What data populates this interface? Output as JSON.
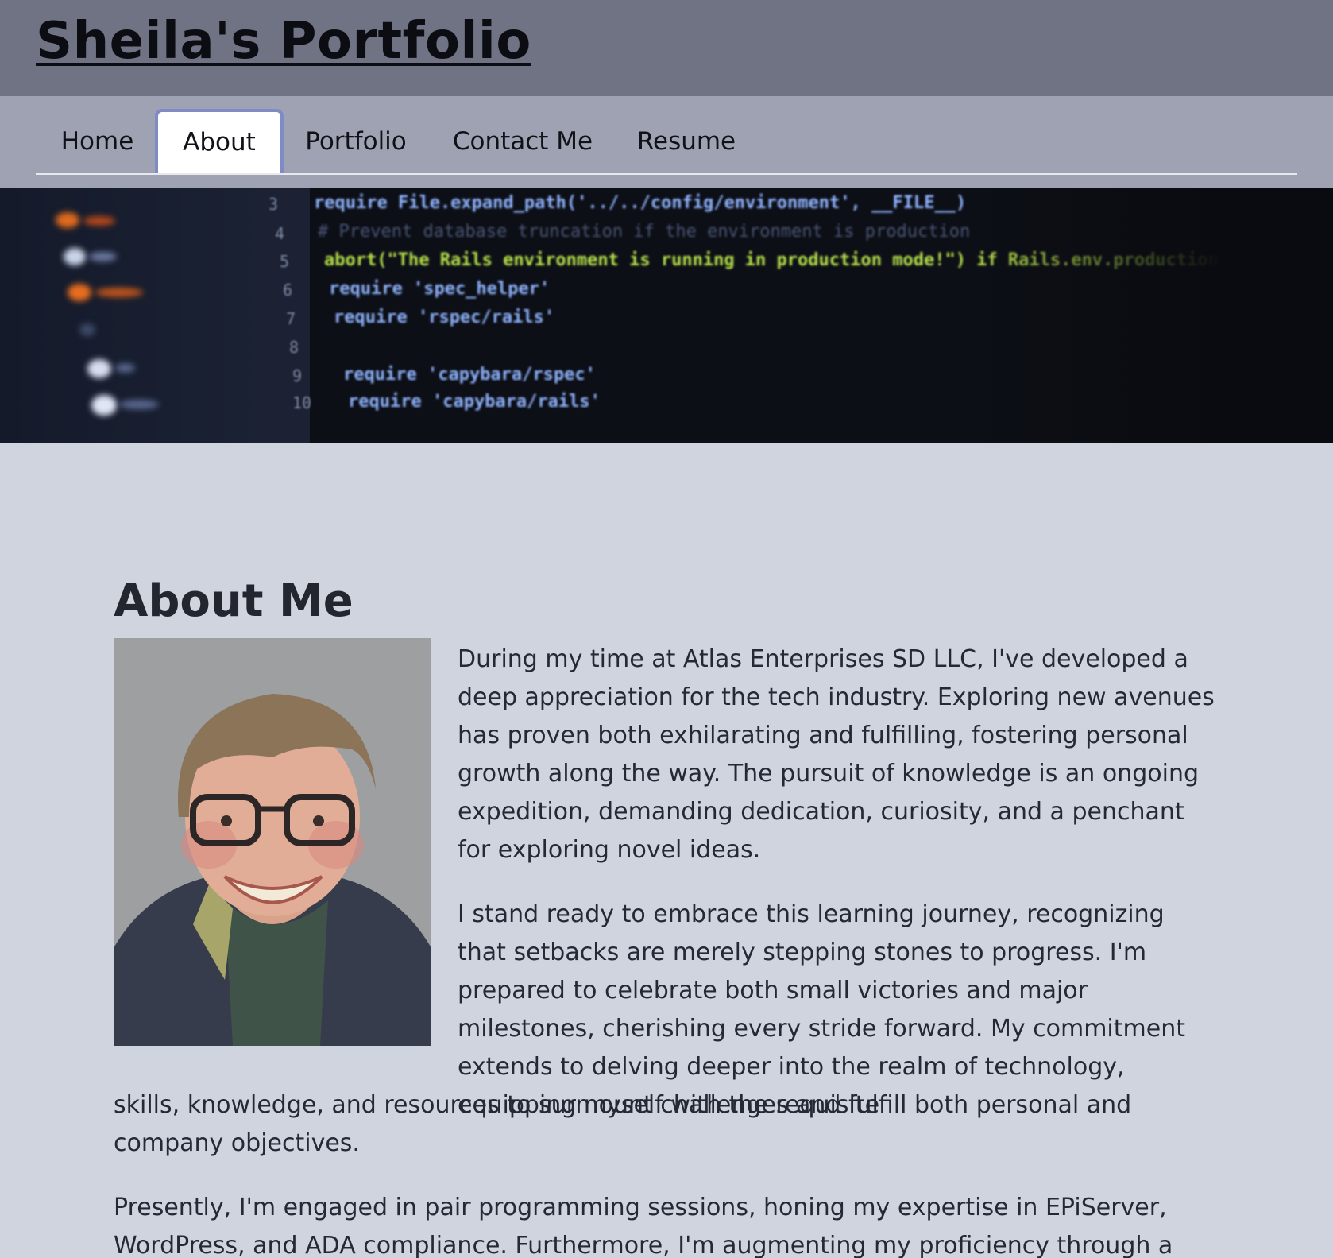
{
  "header": {
    "site_title": "Sheila's Portfolio"
  },
  "nav": {
    "items": [
      {
        "label": "Home",
        "active": false
      },
      {
        "label": "About",
        "active": true
      },
      {
        "label": "Portfolio",
        "active": false
      },
      {
        "label": "Contact Me",
        "active": false
      },
      {
        "label": "Resume",
        "active": false
      }
    ]
  },
  "hero": {
    "description": "blurred code editor banner image",
    "code_lines": [
      {
        "ln": "3",
        "text": "require File.expand_path('../../config/environment', __FILE__)"
      },
      {
        "ln": "4",
        "text": "# Prevent database truncation if the environment is production"
      },
      {
        "ln": "5",
        "text": "abort(\"The Rails environment is running in production mode!\") if Rails.env.production?"
      },
      {
        "ln": "6",
        "text": "require 'spec_helper'"
      },
      {
        "ln": "7",
        "text": "require 'rspec/rails'"
      },
      {
        "ln": "8",
        "text": ""
      },
      {
        "ln": "9",
        "text": "require 'capybara/rspec'"
      },
      {
        "ln": "10",
        "text": "require 'capybara/rails'"
      }
    ]
  },
  "about": {
    "heading": "About Me",
    "photo_alt": "Portrait of Sheila",
    "paragraphs": [
      "During my time at Atlas Enterprises SD LLC, I've developed a deep appreciation for the tech industry. Exploring new avenues has proven both exhilarating and fulfilling, fostering personal growth along the way. The pursuit of knowledge is an ongoing expedition, demanding dedication, curiosity, and a penchant for exploring novel ideas.",
      "I stand ready to embrace this learning journey, recognizing that setbacks are merely stepping stones to progress. I'm prepared to celebrate both small victories and major milestones, cherishing every stride forward. My commitment extends to delving deeper into the realm of technology, equipping myself with the requisite skills, knowledge, and resources to surmount challenges and fulfill both personal and company objectives.",
      "Presently, I'm engaged in pair programming sessions, honing my expertise in EPiServer, WordPress, and ADA compliance. Furthermore, I'm augmenting my proficiency through a"
    ]
  },
  "colors": {
    "header_bg": "#6f7384",
    "nav_bg": "#9ea2b2",
    "page_bg": "#cfd4df",
    "active_tab_border": "#7f8bc4"
  }
}
